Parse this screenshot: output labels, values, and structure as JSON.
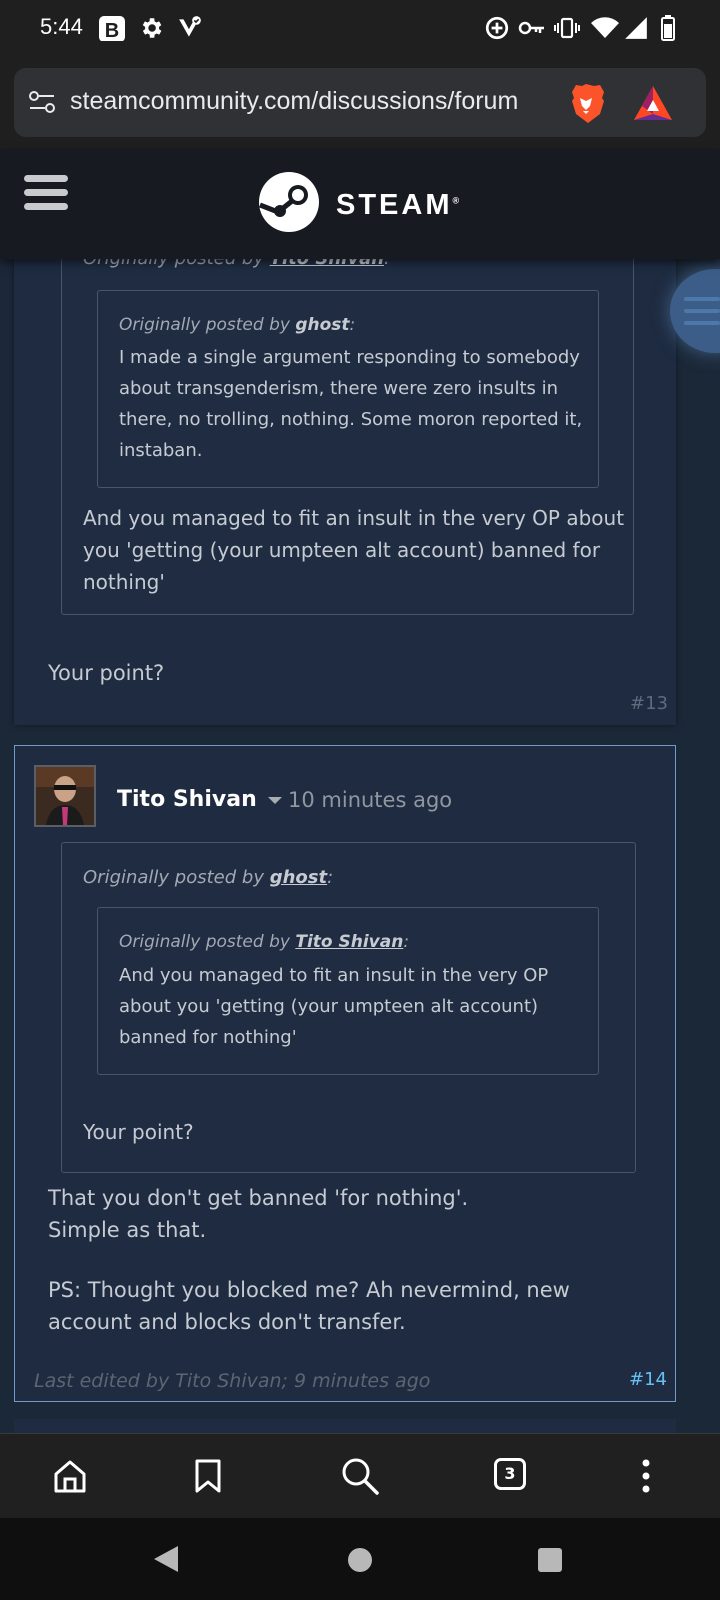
{
  "status_bar": {
    "time": "5:44",
    "icons": [
      "b-app-icon",
      "settings-icon",
      "vpn-shield-icon",
      "data-saver-icon",
      "key-icon",
      "vibrate-icon",
      "wifi-icon",
      "signal-icon",
      "battery-icon"
    ]
  },
  "browser": {
    "url": "steamcommunity.com/discussions/forum",
    "tab_count": "3"
  },
  "header": {
    "brand": "STEAM",
    "registered": "®"
  },
  "post13": {
    "outer_quote": {
      "prefix": "Originally posted by ",
      "author": "Tito Shivan",
      "inner_quote": {
        "prefix": "Originally posted by ",
        "author": "ghost",
        "lines": [
          "I made a single argument responding to somebody",
          "about transgenderism, there were zero insults in",
          "there, no trolling, nothing. Some moron reported it,",
          "instaban."
        ]
      },
      "lines": [
        "And you managed to fit an insult in the very OP about",
        "you 'getting (your umpteen alt account) banned for",
        "nothing'"
      ]
    },
    "body": "Your point?",
    "number": "#13"
  },
  "post14": {
    "author": "Tito Shivan",
    "time": "10 minutes ago",
    "outer_quote": {
      "prefix": "Originally posted by ",
      "author": "ghost",
      "inner_quote": {
        "prefix": "Originally posted by ",
        "author": "Tito Shivan",
        "lines": [
          "And you managed to fit an insult in the very OP",
          "about you 'getting (your umpteen alt account)",
          "banned for nothing'"
        ]
      },
      "body": "Your point?"
    },
    "body_lines": [
      "That you don't get banned 'for nothing'.",
      "Simple as that.",
      "",
      "PS: Thought you blocked me? Ah nevermind, new",
      "account and blocks don't transfer."
    ],
    "edited": "Last edited by Tito Shivan; 9 minutes ago",
    "number": "#14"
  },
  "colors": {
    "page_bg": "#1b2838",
    "post_bg": "#1e2b40",
    "steam_header": "#171a21",
    "accent_link": "#66c0f4",
    "brave_orange": "#fb542b"
  }
}
